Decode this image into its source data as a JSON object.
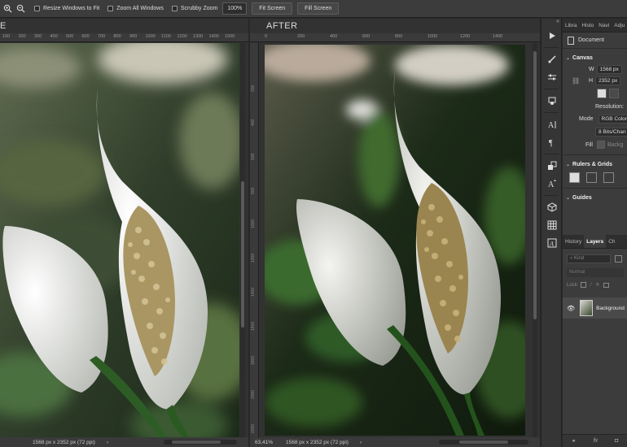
{
  "options_bar": {
    "resize_windows": "Resize Windows to Fit",
    "zoom_all": "Zoom All Windows",
    "scrubby_zoom": "Scrubby Zoom",
    "zoom_percent": "100%",
    "fit_screen": "Fit Screen",
    "fill_screen": "Fill Screen"
  },
  "doc_before": {
    "title": "E",
    "ruler_ticks": [
      "100",
      "200",
      "300",
      "400",
      "500",
      "600",
      "700",
      "800",
      "900",
      "1000",
      "1100",
      "1200",
      "1300",
      "1400",
      "1500"
    ],
    "status_zoom": "",
    "status_size": "1568 px x 2352 px (72 ppi)",
    "status_chevron": "›"
  },
  "doc_after": {
    "title": "AFTER",
    "ruler_ticks": [
      "0",
      "200",
      "400",
      "600",
      "800",
      "1000",
      "1200",
      "1400"
    ],
    "vruler_ticks": [
      "200",
      "400",
      "600",
      "800",
      "1000",
      "1200",
      "1400",
      "1600",
      "1800",
      "2000",
      "2200"
    ],
    "status_zoom": "63,41%",
    "status_size": "1568 px x 2352 px (72 ppi)",
    "status_chevron": "›"
  },
  "tools": [
    "play-icon",
    "brush-settings-icon",
    "adjust-icon",
    "layer-comps-icon",
    "character-icon",
    "paragraph-icon",
    "clone-source-icon",
    "type-icon",
    "3d-cube-icon",
    "grid-icon",
    "glyphs-icon"
  ],
  "panel": {
    "top_tabs": [
      "Libra",
      "Histo",
      "Navi",
      "Adju"
    ],
    "document_label": "Document",
    "canvas_title": "Canvas",
    "w_label": "W",
    "w_value": "1568 px",
    "h_label": "H",
    "h_value": "2352 px",
    "resolution_label": "Resolution:",
    "mode_label": "Mode",
    "mode_value": "RGB Color",
    "bits_value": "8 Bits/Chan",
    "fill_label": "Fill",
    "fill_value": "Backg",
    "rulers_title": "Rulers & Grids",
    "guides_title": "Guides",
    "bottom_tabs": [
      "History",
      "Layers",
      "Ch"
    ],
    "kind_placeholder": "Kind",
    "blend_mode": "Normal",
    "lock_label": "Lock:",
    "layer_name": "Background",
    "bottom_icons": [
      "link-icon",
      "fx-icon",
      "mask-icon"
    ]
  },
  "colors": {
    "bg_dark": "#282828",
    "panel": "#3c3c3c",
    "accent_leaf": "#2f4a2a"
  }
}
